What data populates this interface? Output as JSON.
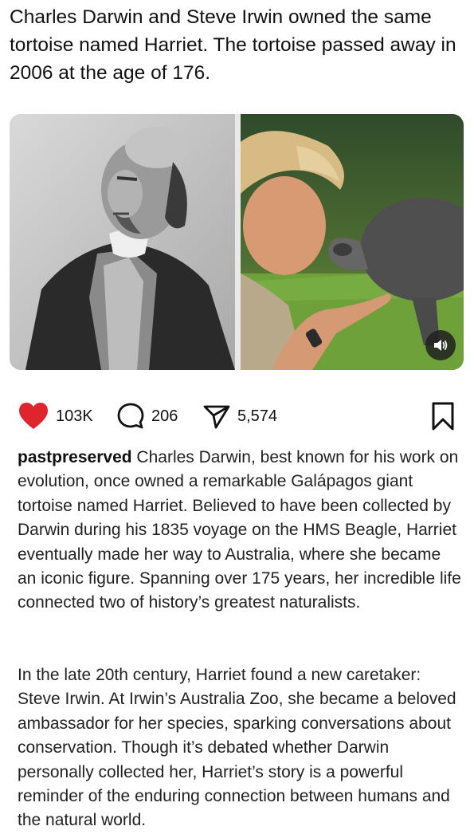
{
  "headline": "Charles Darwin and Steve Irwin owned the same tortoise named Harriet. The tortoise passed away in 2006 at the age of 176.",
  "media": {
    "left_photo": "portrait-photo",
    "right_photo": "man-with-tortoise-photo",
    "sound_icon": "speaker-icon"
  },
  "actions": {
    "likes": "103K",
    "comments": "206",
    "shares": "5,574",
    "like_color": "#e0242e"
  },
  "caption": {
    "username": "pastpreserved",
    "paragraph1": "Charles Darwin, best known for his work on evolution, once owned a remarkable Galápagos giant tortoise named Harriet. Believed to have been collected by Darwin during his 1835 voyage on the HMS Beagle, Harriet eventually made her way to Australia, where she became an iconic figure. Spanning over 175 years, her incredible life connected two of history’s greatest naturalists.",
    "paragraph2": "In the late 20th century, Harriet found a new caretaker: Steve Irwin. At Irwin’s Australia Zoo, she became a beloved ambassador for her species, sparking conversations about conservation. Though it’s debated whether Darwin personally collected her, Harriet’s story is a powerful reminder of the enduring connection between humans and the natural world."
  }
}
